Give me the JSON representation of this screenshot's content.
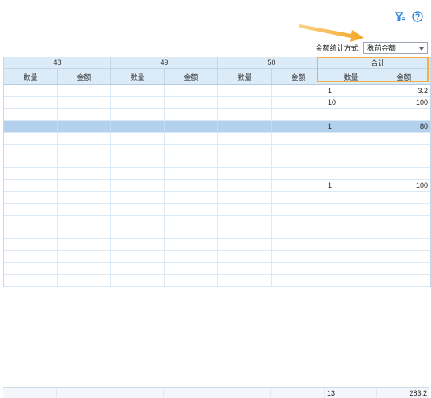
{
  "toolbar": {
    "filter_icon": "filter-settings-icon",
    "help_icon": "help-circle-icon",
    "stat_label": "金额统计方式:",
    "stat_value": "税前金额",
    "dropdown_icon": "chevron-down-icon"
  },
  "accent": "#f5b043",
  "table": {
    "groups": [
      "48",
      "49",
      "50",
      "合计"
    ],
    "subheaders": [
      "数量",
      "金额"
    ],
    "rows": [
      {
        "qty": "1",
        "amount": "3.2"
      },
      {
        "qty": "10",
        "amount": "100"
      },
      {
        "qty": "",
        "amount": ""
      },
      {
        "qty": "1",
        "amount": "80",
        "selected": true
      },
      {
        "qty": "",
        "amount": ""
      },
      {
        "qty": "",
        "amount": ""
      },
      {
        "qty": "",
        "amount": ""
      },
      {
        "qty": "",
        "amount": ""
      },
      {
        "qty": "1",
        "amount": "100"
      },
      {
        "qty": "",
        "amount": ""
      },
      {
        "qty": "",
        "amount": ""
      },
      {
        "qty": "",
        "amount": ""
      },
      {
        "qty": "",
        "amount": ""
      },
      {
        "qty": "",
        "amount": ""
      },
      {
        "qty": "",
        "amount": ""
      },
      {
        "qty": "",
        "amount": ""
      },
      {
        "qty": "",
        "amount": ""
      }
    ],
    "footer": {
      "qty": "13",
      "amount": "283.2"
    }
  }
}
